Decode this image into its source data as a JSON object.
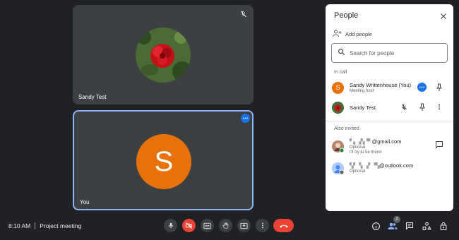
{
  "tiles": {
    "top_name": "Sandy Test",
    "bottom_name": "You",
    "bottom_initial": "S"
  },
  "panel": {
    "title": "People",
    "add_people": "Add people",
    "search_placeholder": "Search for people",
    "in_call_label": "In call",
    "also_invited_label": "Also invited",
    "in_call": [
      {
        "name": "Sandy Writtenhouse (You)",
        "sub": "Meeting host",
        "initial": "S"
      },
      {
        "name": "Sandy Test",
        "sub": ""
      }
    ],
    "invited": [
      {
        "name": "@gmail.com",
        "sub": "Optional",
        "note": "I'll try to be there!"
      },
      {
        "name": "@outlook.com",
        "sub": "Optional"
      }
    ]
  },
  "bottom": {
    "time": "8:10 AM",
    "meeting_name": "Project meeting",
    "people_count": "2"
  },
  "colors": {
    "accent": "#1a73e8",
    "danger": "#ea4335",
    "avatar_orange": "#e8710a",
    "background": "#202124",
    "tile": "#3c4043"
  },
  "icons": [
    "mic-off-icon",
    "more-icon",
    "close-icon",
    "person-add-icon",
    "search-icon",
    "pin-icon",
    "mic-icon",
    "camera-off-icon",
    "captions-icon",
    "raise-hand-icon",
    "present-icon",
    "end-call-icon",
    "info-icon",
    "people-icon",
    "chat-icon",
    "activities-icon",
    "host-controls-icon"
  ]
}
